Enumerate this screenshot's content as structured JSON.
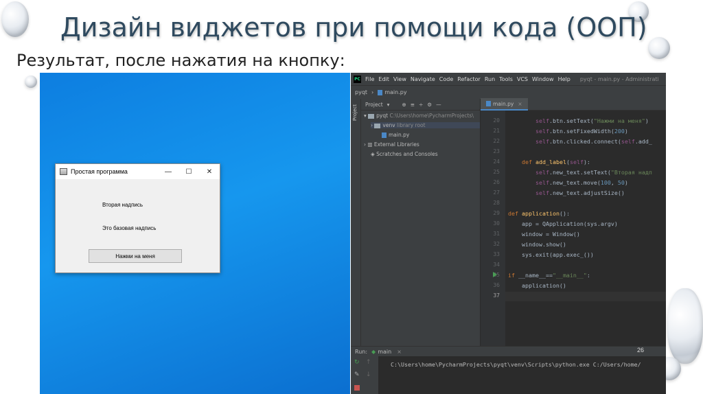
{
  "slide": {
    "title": "Дизайн виджетов при помощи кода (ООП)",
    "subtitle": "Результат, после нажатия на кнопку:",
    "page_number": "26"
  },
  "qt_window": {
    "title": "Простая программа",
    "minimize": "—",
    "maximize": "☐",
    "close": "✕",
    "label_1": "Вторая надпись",
    "label_2": "Это базовая надпись",
    "button": "Нажми на меня"
  },
  "ide": {
    "logo": "PC",
    "menu": [
      "File",
      "Edit",
      "View",
      "Navigate",
      "Code",
      "Refactor",
      "Run",
      "Tools",
      "VCS",
      "Window",
      "Help"
    ],
    "window_title": "pyqt - main.py - Administrati",
    "breadcrumb_project": "pyqt",
    "breadcrumb_file": "main.py",
    "project_panel_label": "Project",
    "sidestrip_label": "Project",
    "tree": {
      "root_name": "pyqt",
      "root_path": "C:\\Users\\home\\PycharmProjects\\",
      "venv_name": "venv",
      "venv_note": "library root",
      "main_file": "main.py",
      "external": "External Libraries",
      "scratches": "Scratches and Consoles"
    },
    "tab": "main.py",
    "line_numbers": [
      "20",
      "21",
      "22",
      "23",
      "24",
      "25",
      "26",
      "27",
      "28",
      "29",
      "30",
      "31",
      "32",
      "33",
      "34",
      "35",
      "36",
      "37"
    ],
    "run_label": "Run:",
    "run_tab": "main",
    "console_text": "C:\\Users\\home\\PycharmProjects\\pyqt\\venv\\Scripts\\python.exe C:/Users/home/"
  },
  "colors": {
    "desktop_blue": "#1697ee",
    "ide_background": "#2b2b2b",
    "title_color": "#2f4a5f"
  }
}
